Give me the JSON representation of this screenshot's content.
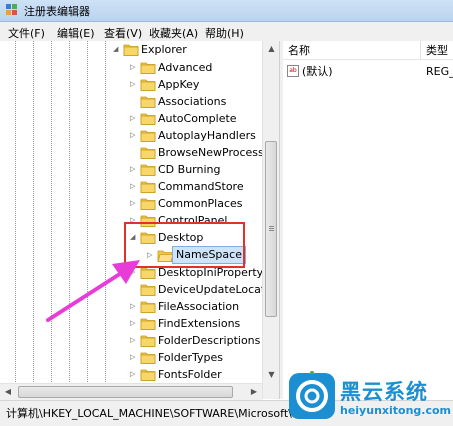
{
  "window": {
    "title": "注册表编辑器",
    "icon": "regedit-icon"
  },
  "menu": [
    "文件(F)",
    "编辑(E)",
    "查看(V)",
    "收藏夹(A)",
    "帮助(H)"
  ],
  "tree": {
    "parent": "Explorer",
    "items": [
      "Advanced",
      "AppKey",
      "Associations",
      "AutoComplete",
      "AutoplayHandlers",
      "BrowseNewProcess",
      "CD Burning",
      "CommandStore",
      "CommonPlaces",
      "ControlPanel",
      "Desktop",
      "NameSpace",
      "DesktopIniPropertyM",
      "DeviceUpdateLocatio",
      "FileAssociation",
      "FindExtensions",
      "FolderDescriptions",
      "FolderTypes",
      "FontsFolder"
    ],
    "selected": "NameSpace",
    "expanded": "Desktop"
  },
  "list": {
    "columns": [
      "名称",
      "类型"
    ],
    "rows": [
      {
        "name": "(默认)",
        "type": "REG_"
      }
    ]
  },
  "status": "计算机\\HKEY_LOCAL_MACHINE\\SOFTWARE\\Microsoft\\W",
  "watermark": {
    "title": "黑云系统",
    "url": "heiyunxitong.com"
  },
  "colors": {
    "highlight_box": "#e0322b",
    "arrow": "#e83cd8",
    "watermark": "#1c8fd2"
  }
}
